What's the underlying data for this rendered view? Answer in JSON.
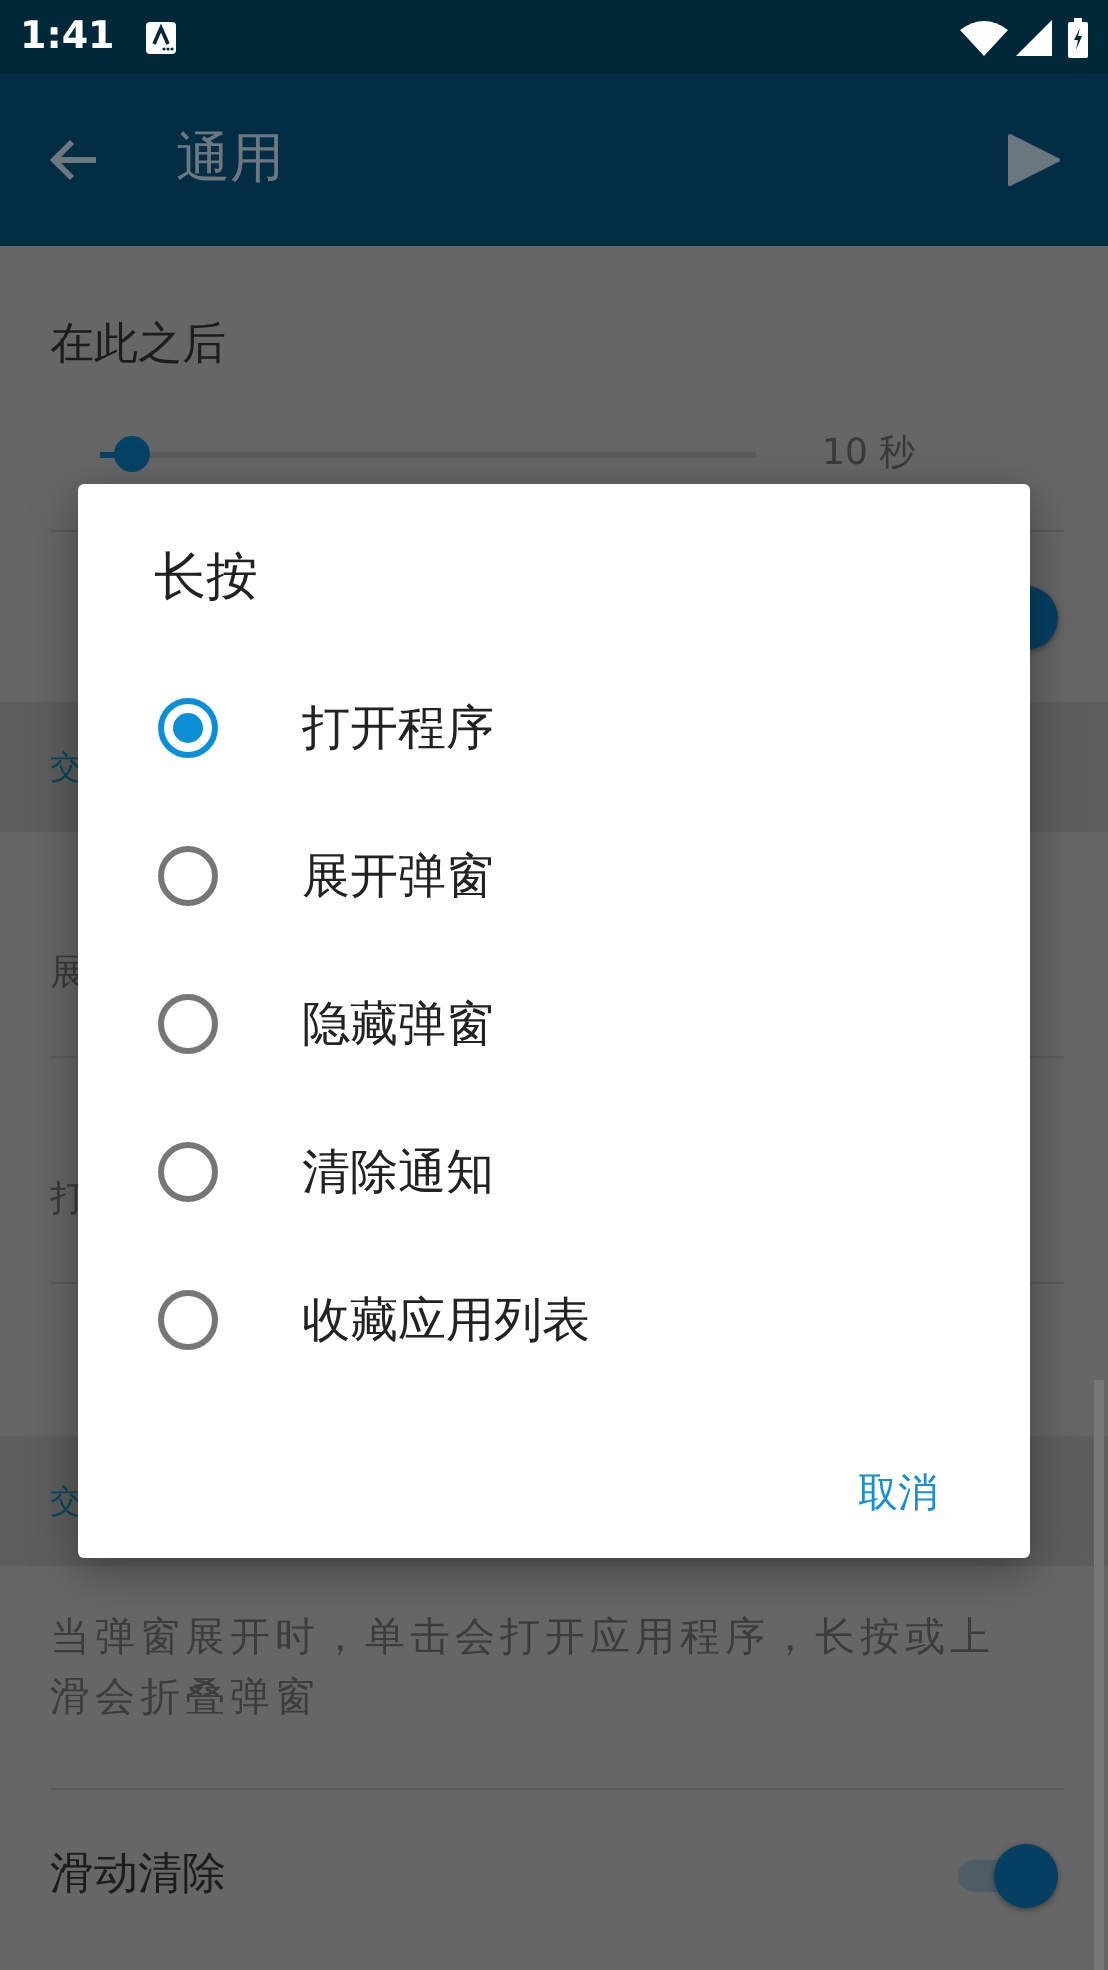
{
  "status_bar": {
    "time": "1:41"
  },
  "app_bar": {
    "title": "通用"
  },
  "settings": [
    {
      "kind": "slider",
      "title": "在此之后",
      "level": 0.05,
      "reading": "10 秒"
    },
    {
      "kind": "switch",
      "on": true
    },
    {
      "kind": "header",
      "title": "交"
    },
    {
      "kind": "two_line",
      "summary": "展"
    },
    {
      "kind": "two_line",
      "summary": "打"
    },
    {
      "kind": "plain"
    },
    {
      "kind": "header",
      "title": "交"
    },
    {
      "kind": "description",
      "text": "当弹窗展开时，单击会打开应用程序，长按或上滑会折叠弹窗"
    },
    {
      "kind": "switch",
      "title": "滑动清除",
      "on": true
    }
  ],
  "dialog": {
    "title": "长按",
    "options": [
      {
        "label": "打开程序",
        "selected": true
      },
      {
        "label": "展开弹窗",
        "selected": false
      },
      {
        "label": "隐藏弹窗",
        "selected": false
      },
      {
        "label": "清除通知",
        "selected": false
      },
      {
        "label": "收藏应用列表",
        "selected": false
      }
    ],
    "buttons": [
      "取消"
    ]
  }
}
